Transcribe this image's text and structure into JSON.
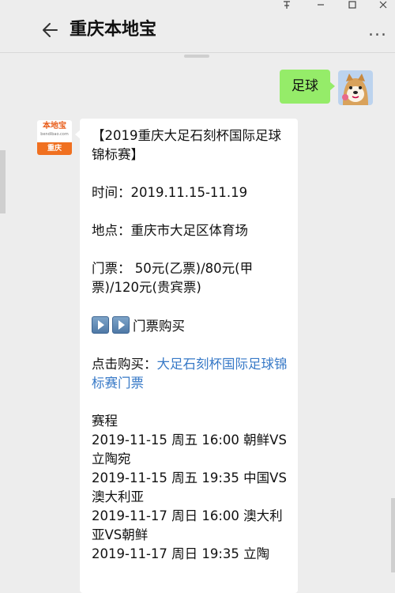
{
  "window": {
    "pin_icon": "pin-icon",
    "minimize_icon": "minimize-icon",
    "maximize_icon": "maximize-icon",
    "close_icon": "close-icon"
  },
  "header": {
    "title": "重庆本地宝",
    "back_icon": "arrow-left-icon",
    "more_label": "..."
  },
  "user_message": {
    "text": "足球"
  },
  "bot_avatar": {
    "top_text": "本地宝",
    "url_text": "bendibao.com",
    "band_text": "重庆"
  },
  "bot_message": {
    "title_line": "【2019重庆大足石刻杯国际足球锦标赛】",
    "time_line": "时间：2019.11.15-11.19",
    "place_line": "地点：重庆市大足区体育场",
    "ticket_line": "门票：    50元(乙票)/80元(甲票)/120元(贵宾票)",
    "buy_label": "门票购买",
    "click_prefix": "点击购买：",
    "click_link": "大足石刻杯国际足球锦标赛门票",
    "schedule_title": "赛程",
    "schedule": [
      "2019-11-15 周五 16:00 朝鲜VS立陶宛",
      "2019-11-15 周五 19:35 中国VS澳大利亚",
      "2019-11-17 周日 16:00 澳大利亚VS朝鲜",
      "2019-11-17 周日 19:35 立陶"
    ]
  },
  "colors": {
    "background": "#ededed",
    "user_bubble": "#95ec69",
    "link": "#3779c7",
    "logo_orange": "#f07020"
  }
}
